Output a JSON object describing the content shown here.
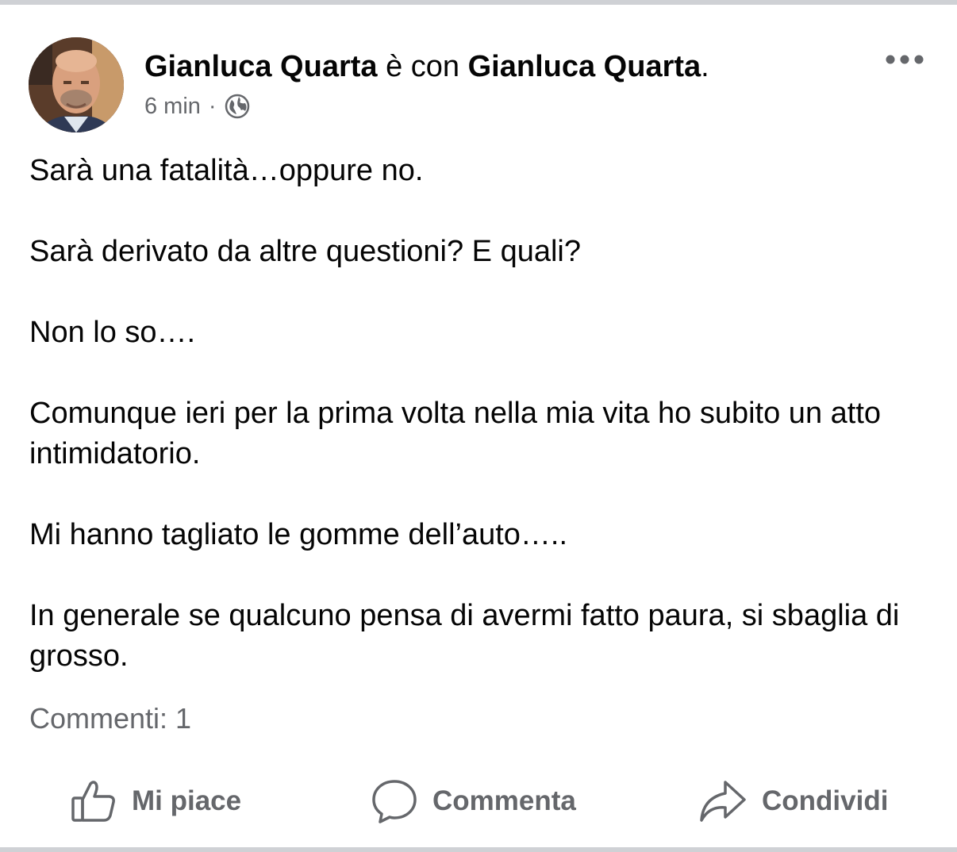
{
  "post": {
    "author": "Gianluca Quarta",
    "with_text": " è con ",
    "tagged": "Gianluca Quarta",
    "header_end": ".",
    "time": "6 min",
    "separator": "·",
    "audience_icon": "globe-icon",
    "more_icon": "more-options-icon",
    "paragraphs": [
      "Sarà una fatalità…oppure no.",
      "Sarà derivato da altre questioni? E quali?",
      "Non lo so….",
      "Comunque ieri per la prima volta nella mia vita ho subito un atto intimidatorio.",
      "Mi hanno tagliato le gomme dell’auto…..",
      "In generale se qualcuno pensa di avermi fatto paura, si sbaglia di grosso."
    ],
    "comments_label": "Commenti: 1"
  },
  "actions": {
    "like_label": "Mi piace",
    "comment_label": "Commenta",
    "share_label": "Condividi",
    "like_icon": "thumbs-up-icon",
    "comment_icon": "speech-bubble-icon",
    "share_icon": "share-arrow-icon"
  },
  "colors": {
    "text_primary": "#050505",
    "text_secondary": "#65676b",
    "divider": "#cfd1d5"
  }
}
